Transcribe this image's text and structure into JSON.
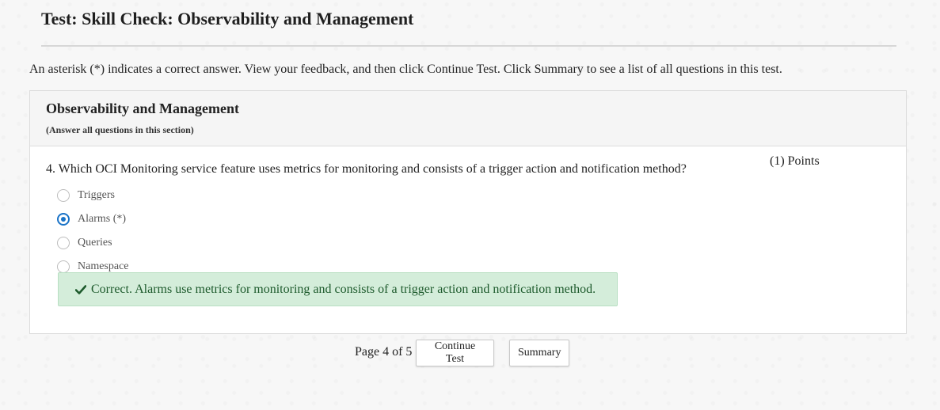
{
  "page": {
    "title": "Test: Skill Check: Observability and Management",
    "instructions": "An asterisk (*) indicates a correct answer. View your feedback, and then click Continue Test. Click Summary to see a list of all questions in this test."
  },
  "section": {
    "title": "Observability and Management",
    "subtitle": "(Answer all questions in this section)"
  },
  "question": {
    "text": "4. Which OCI Monitoring service feature uses metrics for monitoring and consists of a trigger action and notification method?",
    "points": "(1) Points",
    "options": [
      {
        "label": "Triggers",
        "selected": false
      },
      {
        "label": "Alarms (*)",
        "selected": true
      },
      {
        "label": "Queries",
        "selected": false
      },
      {
        "label": "Namespace",
        "selected": false
      }
    ],
    "feedback": "Correct. Alarms use metrics for monitoring and consists of a trigger action and notification method."
  },
  "footer": {
    "page_info": "Page 4 of 5",
    "continue_label": "Continue Test",
    "summary_label": "Summary"
  },
  "colors": {
    "radio_selected": "#1a73c7",
    "feedback_bg": "#d4edda",
    "feedback_text": "#1d5a2c"
  },
  "icons": {
    "feedback_icon": "check-icon"
  }
}
